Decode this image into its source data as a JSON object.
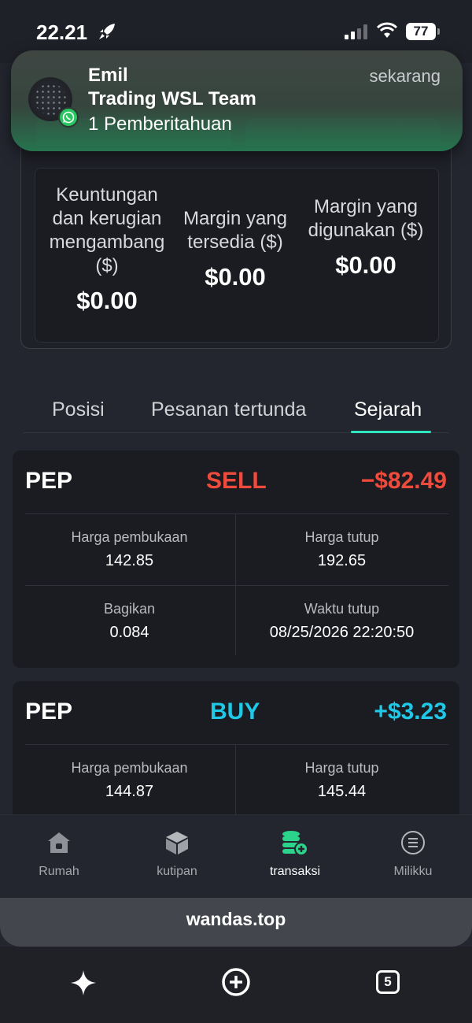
{
  "status_bar": {
    "time": "22.21",
    "battery": "77"
  },
  "notification": {
    "sender": "Emil",
    "group": "Trading WSL Team",
    "body": "1 Pemberitahuan",
    "time": "sekarang"
  },
  "stats": [
    {
      "label": "Keuntungan dan kerugian mengambang ($)",
      "value": "$0.00"
    },
    {
      "label": "Margin yang tersedia ($)",
      "value": "$0.00"
    },
    {
      "label": "Margin yang digunakan ($)",
      "value": "$0.00"
    }
  ],
  "tabs": [
    {
      "label": "Posisi",
      "active": false
    },
    {
      "label": "Pesanan tertunda",
      "active": false
    },
    {
      "label": "Sejarah",
      "active": true
    }
  ],
  "trades": [
    {
      "symbol": "PEP",
      "side": "SELL",
      "pnl": "−$82.49",
      "side_color": "#ef4b3d",
      "pnl_color": "#ef4b3d",
      "open_label": "Harga pembukaan",
      "open_value": "142.85",
      "close_label": "Harga tutup",
      "close_value": "192.65",
      "shares_label": "Bagikan",
      "shares_value": "0.084",
      "close_time_label": "Waktu tutup",
      "close_time_value": "08/25/2026 22:20:50"
    },
    {
      "symbol": "PEP",
      "side": "BUY",
      "pnl": "+$3.23",
      "side_color": "#1ec8e6",
      "pnl_color": "#1ec8e6",
      "open_label": "Harga pembukaan",
      "open_value": "144.87",
      "close_label": "Harga tutup",
      "close_value": "145.44"
    }
  ],
  "bottom_nav": [
    {
      "label": "Rumah",
      "icon": "home-icon"
    },
    {
      "label": "kutipan",
      "icon": "cube-icon"
    },
    {
      "label": "transaksi",
      "icon": "coins-add-icon",
      "active": true
    },
    {
      "label": "Milikku",
      "icon": "menu-circle-icon"
    }
  ],
  "browser": {
    "url": "wandas.top",
    "tabs_count": "5"
  },
  "colors": {
    "accent": "#2ee6c0",
    "sell": "#ef4b3d",
    "buy": "#1ec8e6",
    "nav_active": "#2bd48a"
  }
}
